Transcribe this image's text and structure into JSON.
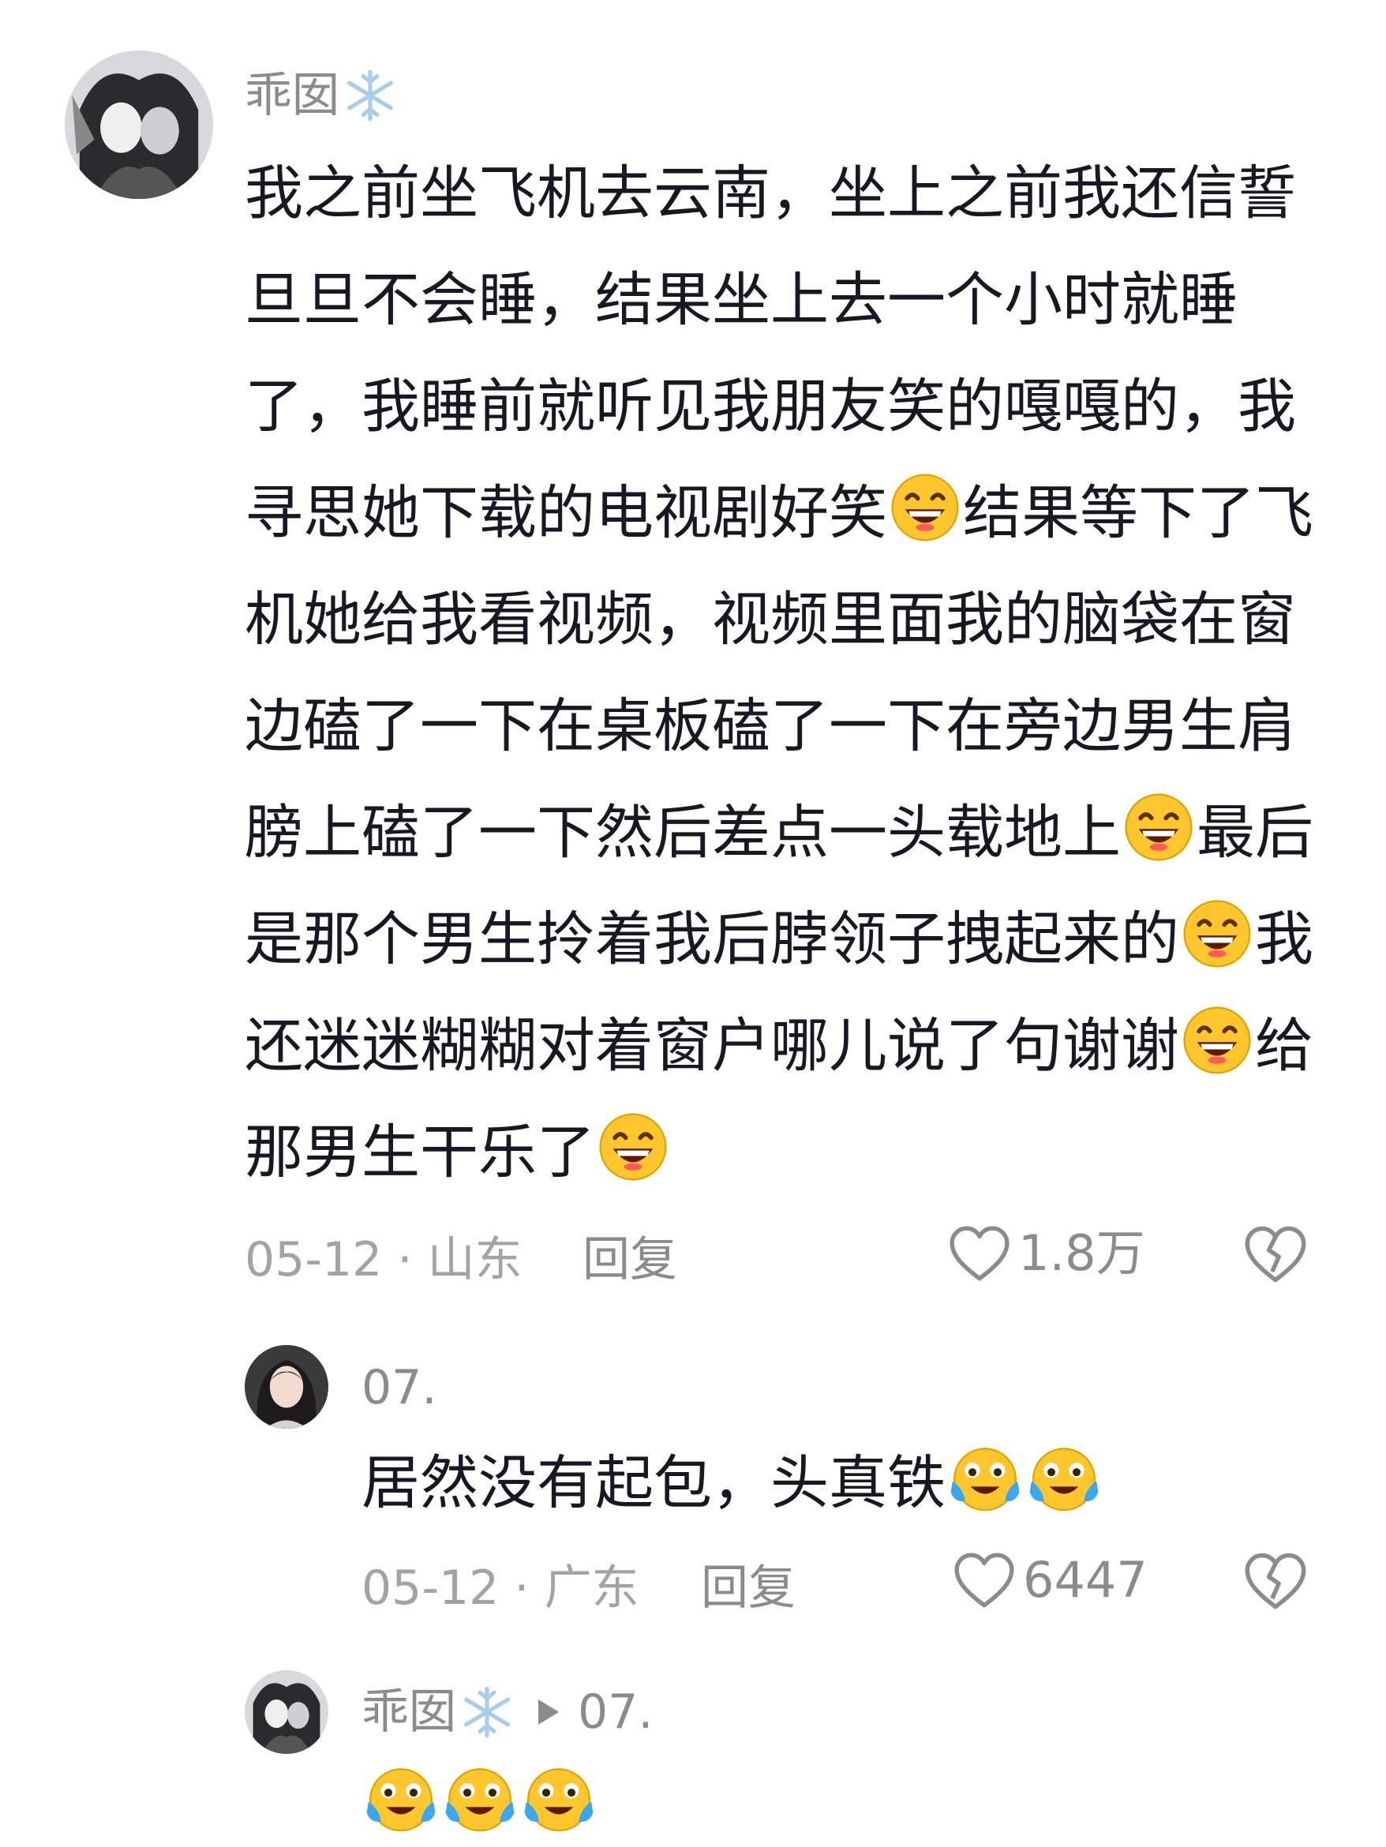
{
  "comment": {
    "username": "乖囡",
    "lines": [
      "我之前坐飞机去云南，坐上之前我还信誓",
      "旦旦不会睡，结果坐上去一个小时就睡",
      "了，我睡前就听见我朋友笑的嘎嘎的，我",
      "寻思她下载的电视剧好笑",
      "结果等下了飞",
      "机她给我看视频，视频里面我的脑袋在窗",
      "边磕了一下在桌板磕了一下在旁边男生肩",
      "膀上磕了一下然后差点一头载地上",
      "最后",
      "是那个男生拎着我后脖领子拽起来的",
      "我",
      "还迷迷糊糊对着窗户哪儿说了句谢谢",
      "给",
      "那男生干乐了"
    ],
    "date_location": "05-12 · 山东",
    "reply_label": "回复",
    "like_count": "1.8万",
    "emoji_name": "grin-emoji"
  },
  "reply1": {
    "username": "07.",
    "text": "居然没有起包，头真铁",
    "date_location": "05-12 · 广东",
    "reply_label": "回复",
    "like_count": "6447",
    "emoji_name": "crying-laughing-emoji"
  },
  "reply2": {
    "username": "乖囡",
    "reply_to": "07.",
    "emoji_name": "crying-laughing-emoji"
  },
  "colors": {
    "text": "#161823",
    "muted": "#8a8b91",
    "meta": "#a1a3a8",
    "emoji_yellow": "#ffc62e",
    "snow_blue": "#a9cdea"
  }
}
